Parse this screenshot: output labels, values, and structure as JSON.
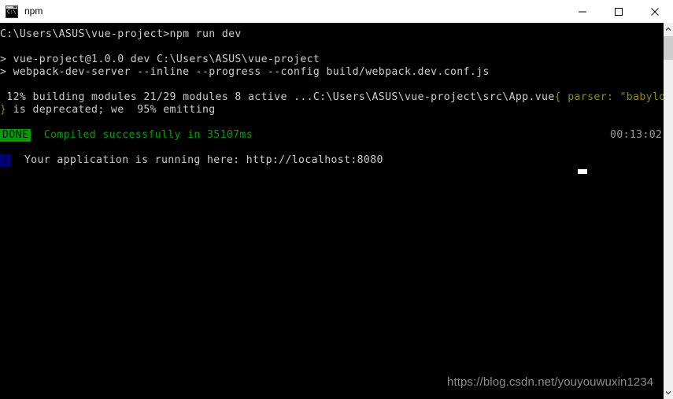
{
  "window": {
    "title": "npm",
    "icon": "console-icon",
    "icon_text": "C:\\",
    "controls": {
      "minimize": "minimize-button",
      "maximize": "maximize-button",
      "close": "close-button"
    }
  },
  "terminal": {
    "background_color": "#000000",
    "foreground_color": "#cccccc",
    "lines": [
      {
        "id": "prompt-line",
        "segments": [
          {
            "text": "C:\\Users\\ASUS\\vue-project>npm run dev",
            "color": "#cccccc"
          }
        ]
      },
      {
        "id": "blank-1",
        "segments": [
          {
            "text": " ",
            "color": "#cccccc"
          }
        ]
      },
      {
        "id": "npm-script-name",
        "segments": [
          {
            "text": "> vue-project@1.0.0 dev C:\\Users\\ASUS\\vue-project",
            "color": "#cccccc"
          }
        ]
      },
      {
        "id": "npm-script-command",
        "segments": [
          {
            "text": "> webpack-dev-server --inline --progress --config build/webpack.dev.conf.js",
            "color": "#cccccc"
          }
        ]
      },
      {
        "id": "blank-2",
        "segments": [
          {
            "text": " ",
            "color": "#cccccc"
          }
        ]
      },
      {
        "id": "build-progress-line",
        "segments": [
          {
            "text": " 12% building modules 21/29 modules 8 active ...C:\\Users\\ASUS\\vue-project\\src\\App.vue",
            "color": "#cccccc"
          },
          {
            "text": "{ parser: \"babylon\"",
            "color": "#8a8a12"
          }
        ]
      },
      {
        "id": "deprecated-line",
        "segments": [
          {
            "text": "}",
            "color": "#8a8a12"
          },
          {
            "text": " is deprecated; we  95% emitting",
            "color": "#cccccc"
          }
        ]
      },
      {
        "id": "blank-3",
        "segments": [
          {
            "text": " ",
            "color": "#cccccc"
          }
        ]
      }
    ],
    "done_line": {
      "badge": "DONE",
      "badge_bg": "#00a000",
      "badge_fg": "#000000",
      "message": "Compiled successfully in 35107ms",
      "message_color": "#00a000",
      "timestamp": "00:13:02",
      "timestamp_color": "#9a9a9a"
    },
    "blank_after_done": " ",
    "info_line": {
      "badge": "I",
      "badge_bg": "#00007e",
      "message": "Your application is running here: http://localhost:8080",
      "message_color": "#cccccc"
    },
    "cursor": {
      "visible": true,
      "color": "#ffffff"
    }
  },
  "watermark": {
    "text": "https://blog.csdn.net/youyouwuxin1234",
    "color": "#8e8e8e"
  },
  "scrollbar": {
    "up_arrow": "chevron-up-icon",
    "down_arrow": "chevron-down-icon",
    "thumb_color": "#cdcdcd",
    "track_color": "#f0f0f0"
  }
}
